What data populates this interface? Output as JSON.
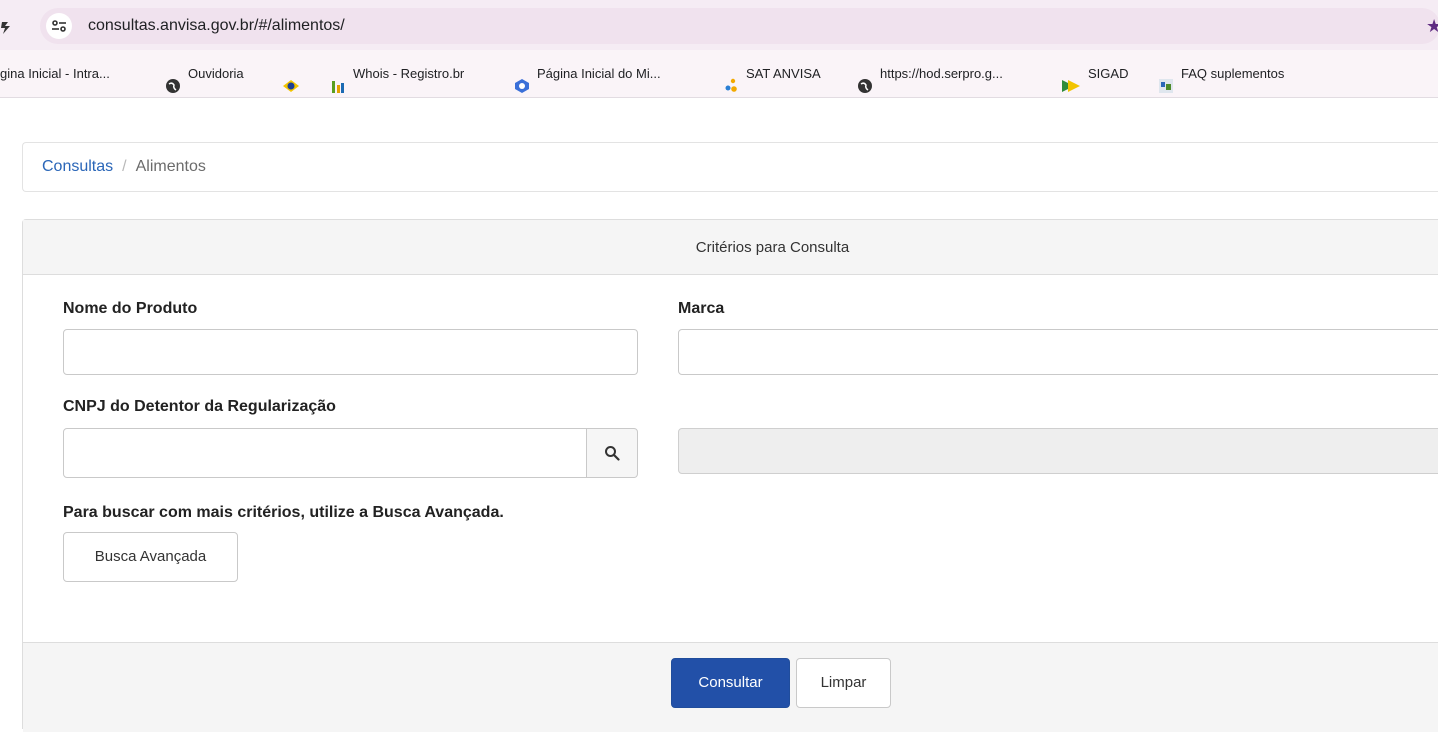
{
  "browser": {
    "url": "consultas.anvisa.gov.br/#/alimentos/",
    "bookmarks": [
      {
        "label": "gina Inicial - Intra...",
        "icon": "none"
      },
      {
        "label": "Ouvidoria",
        "icon": "globe-icon"
      },
      {
        "label": "",
        "icon": "gov-flag-icon"
      },
      {
        "label": "Whois - Registro.br",
        "icon": "registro-br-icon"
      },
      {
        "label": "Página Inicial do Mi...",
        "icon": "ms-copilot-icon"
      },
      {
        "label": "SAT ANVISA",
        "icon": "sat-dots-icon"
      },
      {
        "label": "https://hod.serpro.g...",
        "icon": "globe-icon"
      },
      {
        "label": "SIGAD",
        "icon": "sigad-icon"
      },
      {
        "label": "FAQ suplementos",
        "icon": "faq-icon"
      }
    ]
  },
  "breadcrumb": {
    "link": "Consultas",
    "separator": "/",
    "current": "Alimentos"
  },
  "panel": {
    "heading": "Critérios para Consulta",
    "fields": {
      "nome_produto": {
        "label": "Nome do Produto",
        "value": ""
      },
      "marca": {
        "label": "Marca",
        "value": ""
      },
      "cnpj": {
        "label": "CNPJ do Detentor da Regularização",
        "value": ""
      },
      "detentor_nome": {
        "value": ""
      }
    },
    "hint": "Para buscar com mais critérios, utilize a Busca Avançada.",
    "advanced_button": "Busca Avançada",
    "footer": {
      "submit": "Consultar",
      "clear": "Limpar"
    }
  },
  "colors": {
    "primary": "#2250a8",
    "link": "#2a66b8",
    "chrome": "#f5ecf4"
  }
}
